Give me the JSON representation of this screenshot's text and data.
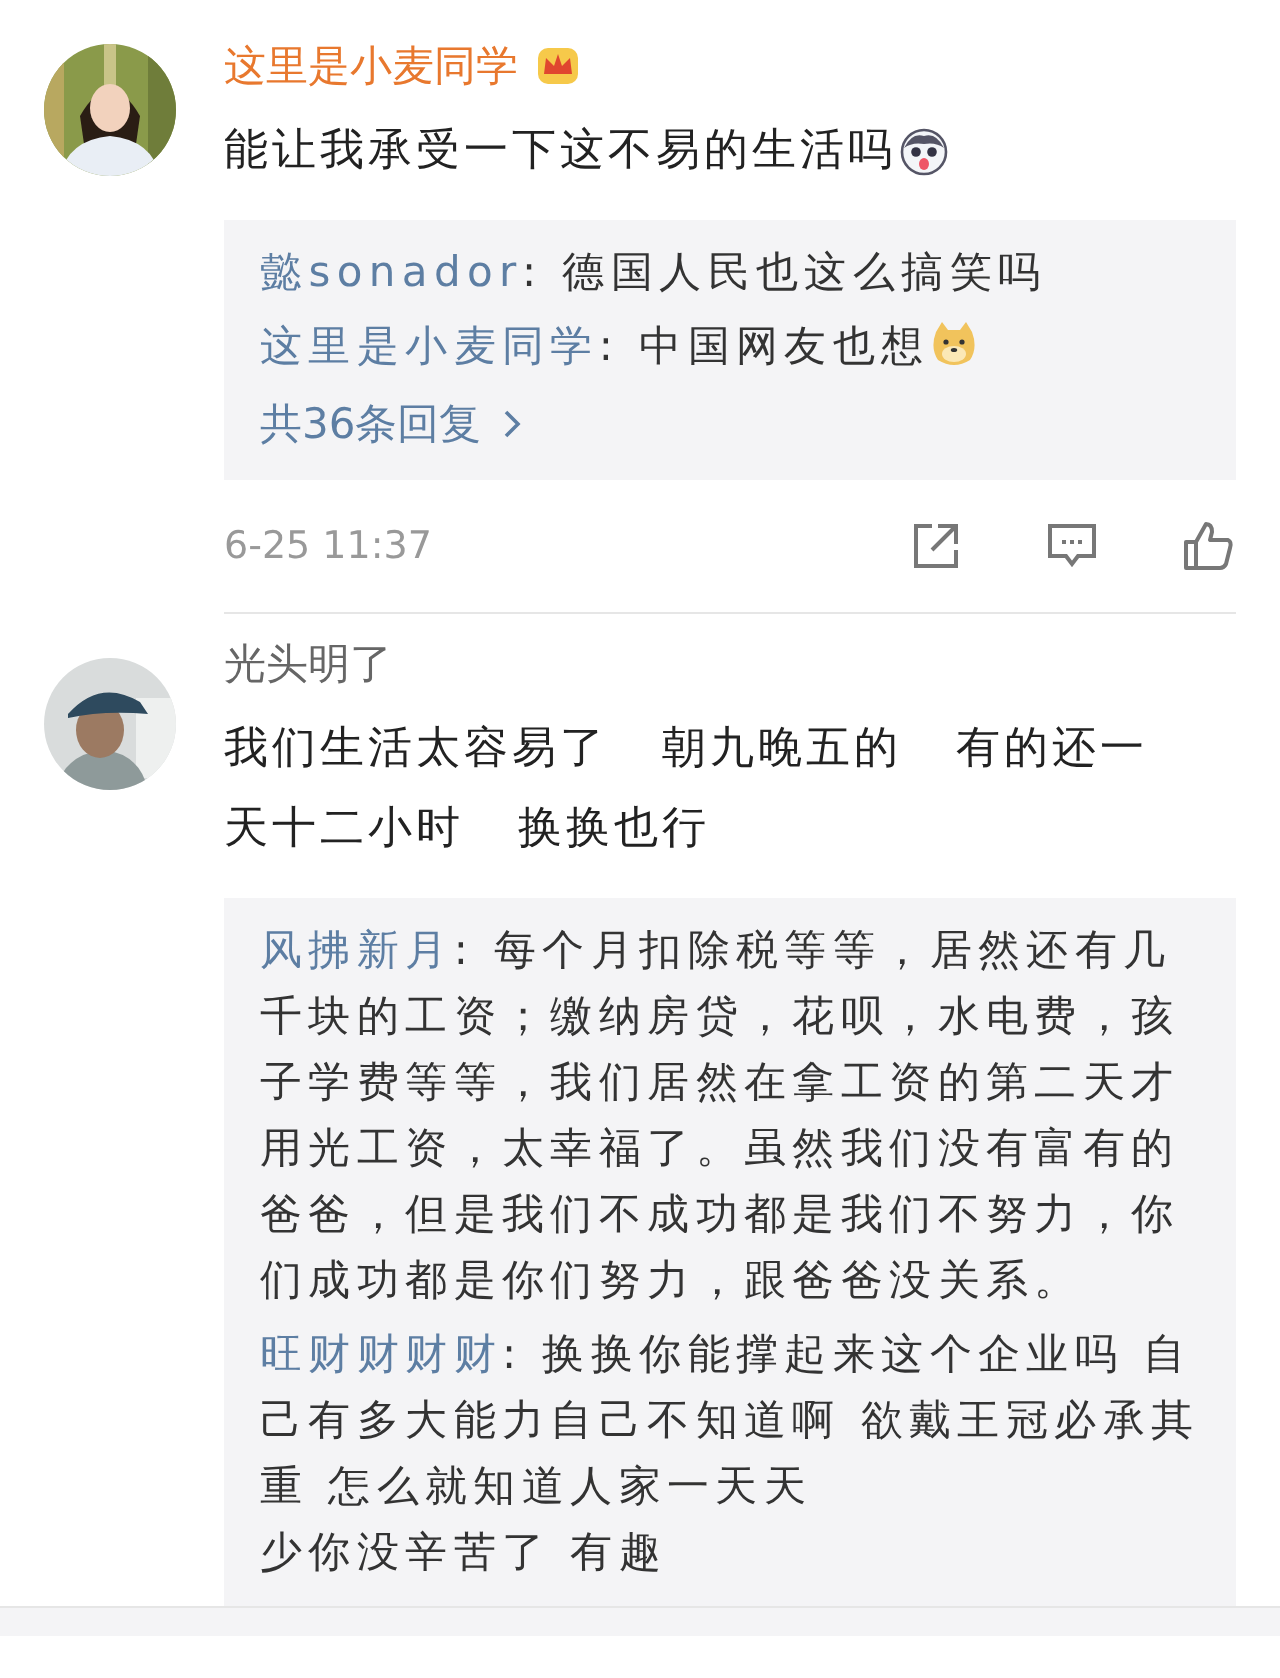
{
  "comments": [
    {
      "author": "这里是小麦同学",
      "vip": true,
      "text": "能让我承受一下这不易的生活吗",
      "text_emoji": true,
      "replies": [
        {
          "author": "懿sonador",
          "separator": ":",
          "lines": [
            "德国人民也这么搞笑吗"
          ],
          "emoji": false
        },
        {
          "author": "这里是小麦同学",
          "separator": ":",
          "lines": [
            "中国网友也想"
          ],
          "emoji": true
        }
      ],
      "more_replies": "共36条回复",
      "time": "6-25 11:37"
    },
    {
      "author": "光头明了",
      "vip": false,
      "text": "我们生活太容易了   朝九晚五的   有的还一天十二小时   换换也行",
      "text_emoji": false,
      "replies": [
        {
          "author": "风拂新月",
          "separator": ":",
          "lines": [
            "每个月扣除税等等，居然还有几千块的工资；缴纳房贷，花呗，水电费，孩子学费等等，我们居然在拿工资的第二天才用光工资，太幸福了。虽然我们没有富有的爸爸，但是我们不成功都是我们不努力，你们成功都是你们努力，跟爸爸没关系。"
          ],
          "emoji": false
        },
        {
          "author": "旺财财财财",
          "separator": ":",
          "lines": [
            "换换你能撑起来这个企业吗 自己有多大能力自己不知道啊 欲戴王冠必承其重 怎么就知道人家一天天",
            "少你没辛苦了 有趣"
          ],
          "emoji": false
        }
      ]
    }
  ]
}
